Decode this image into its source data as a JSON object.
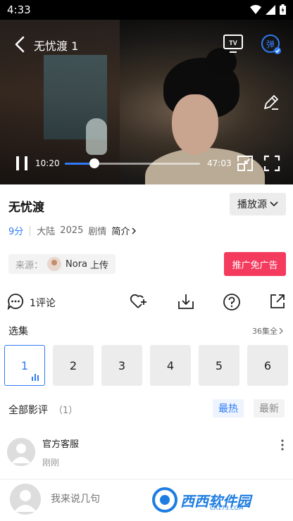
{
  "status": {
    "time": "4:33"
  },
  "player": {
    "title": "无忧渡 1",
    "current_time": "10:20",
    "total_time": "47:03",
    "progress": 0.22,
    "danmu_label": "弹",
    "tv_label": "TV"
  },
  "info": {
    "title": "无忧渡",
    "source_label": "播放源",
    "score": "9分",
    "region": "大陆",
    "year": "2025",
    "genre": "剧情",
    "intro_label": "简介",
    "uploader_prefix": "来源：",
    "uploader_name": "Nora",
    "uploader_suffix": "上传",
    "promo_label": "推广免广告"
  },
  "actions": {
    "comment_count": "1评论"
  },
  "episodes": {
    "header": "选集",
    "all_label": "36集全",
    "items": [
      "1",
      "2",
      "3",
      "4",
      "5",
      "6"
    ]
  },
  "reviews": {
    "title": "全部影评",
    "count": "（1）",
    "sort_hot": "最热",
    "sort_new": "最新",
    "items": [
      {
        "name": "官方客服",
        "time": "刚刚"
      }
    ]
  },
  "composer": {
    "placeholder": "我来说几句"
  },
  "watermark": {
    "text": "西西软件园",
    "sub": "CR173.COM"
  },
  "colors": {
    "accent": "#2f7bf5",
    "promo": "#f43b5e"
  }
}
